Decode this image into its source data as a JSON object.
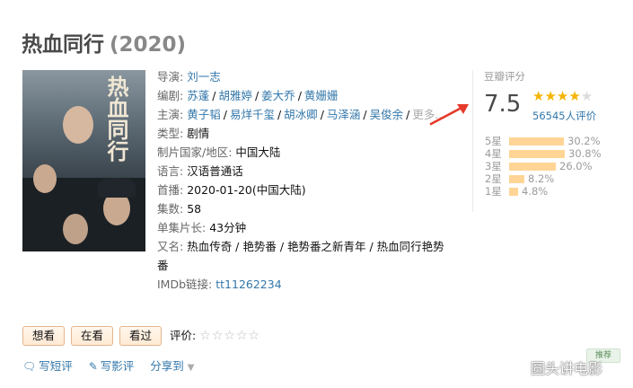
{
  "title": "热血同行",
  "year": "(2020)",
  "info": {
    "director_label": "导演:",
    "director": "刘一志",
    "writers_label": "编剧:",
    "writers": [
      "苏蓬",
      "胡雅婷",
      "姜大乔",
      "黄姗姗"
    ],
    "cast_label": "主演:",
    "cast": [
      "黄子韬",
      "易烊千玺",
      "胡冰卿",
      "马泽涵",
      "吴俊余"
    ],
    "cast_more": "更多...",
    "genre_label": "类型:",
    "genre": "剧情",
    "region_label": "制片国家/地区:",
    "region": "中国大陆",
    "language_label": "语言:",
    "language": "汉语普通话",
    "premiere_label": "首播:",
    "premiere": "2020-01-20(中国大陆)",
    "episodes_label": "集数:",
    "episodes": "58",
    "runtime_label": "单集片长:",
    "runtime": "43分钟",
    "aka_label": "又名:",
    "aka": "热血传奇 / 艳势番 / 艳势番之新青年 / 热血同行艳势番",
    "imdb_label": "IMDb链接:",
    "imdb": "tt11262234"
  },
  "rating": {
    "label": "豆瓣评分",
    "score": "7.5",
    "stars_on": 4,
    "count": "56545人评价",
    "distribution": [
      {
        "label": "5星",
        "percent": 30.2,
        "text": "30.2%"
      },
      {
        "label": "4星",
        "percent": 30.8,
        "text": "30.8%"
      },
      {
        "label": "3星",
        "percent": 26.0,
        "text": "26.0%"
      },
      {
        "label": "2星",
        "percent": 8.2,
        "text": "8.2%"
      },
      {
        "label": "1星",
        "percent": 4.8,
        "text": "4.8%"
      }
    ]
  },
  "actions": {
    "want": "想看",
    "watching": "在看",
    "watched": "看过",
    "rate_label": "评价:"
  },
  "links": {
    "short_review": "写短评",
    "long_review": "写影评",
    "share": "分享到"
  },
  "tag": "推荐",
  "watermark": "圆头讲电影",
  "colors": {
    "link": "#3377aa",
    "star": "#f4b400",
    "bar": "#ffd596",
    "arrow": "#e53a2a"
  }
}
